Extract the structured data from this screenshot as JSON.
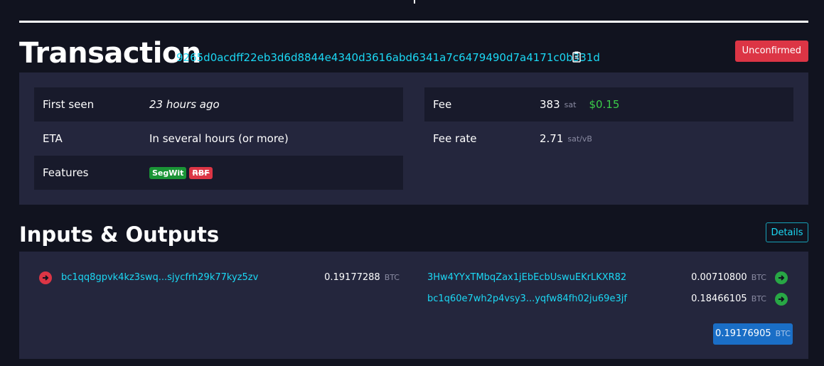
{
  "header": {
    "title": "Transaction",
    "txid": "9265d0acdff22eb3d6d8844e4340d3616abd6341a7c6479490d7a4171c0b331d",
    "status": "Unconfirmed"
  },
  "info": {
    "first_seen_label": "First seen",
    "first_seen_value": "23 hours ago",
    "eta_label": "ETA",
    "eta_value": "In several hours (or more)",
    "features_label": "Features",
    "features": [
      "SegWit",
      "RBF"
    ],
    "fee_label": "Fee",
    "fee_value": "383",
    "fee_unit": "sat",
    "fee_fiat": "$0.15",
    "fee_rate_label": "Fee rate",
    "fee_rate_value": "2.71",
    "fee_rate_unit": "sat/vB"
  },
  "io": {
    "title": "Inputs & Outputs",
    "details_label": "Details",
    "inputs": [
      {
        "address": "bc1qq8gpvk4kz3swq...sjycfrh29k77kyz5zv",
        "amount": "0.19177288",
        "unit": "BTC"
      }
    ],
    "outputs": [
      {
        "address": "3Hw4YYxTMbqZax1jEbEcbUswuEKrLKXR82",
        "amount": "0.00710800",
        "unit": "BTC"
      },
      {
        "address": "bc1q60e7wh2p4vsy3...yqfw84fh02ju69e3jf",
        "amount": "0.18466105",
        "unit": "BTC"
      }
    ],
    "total_amount": "0.19176905",
    "total_unit": "BTC"
  },
  "colors": {
    "background": "#11131f",
    "panel": "#24263d",
    "link": "#1bd8f4",
    "danger": "#dc3545",
    "success": "#28a745",
    "primary": "#1a6ec6"
  }
}
